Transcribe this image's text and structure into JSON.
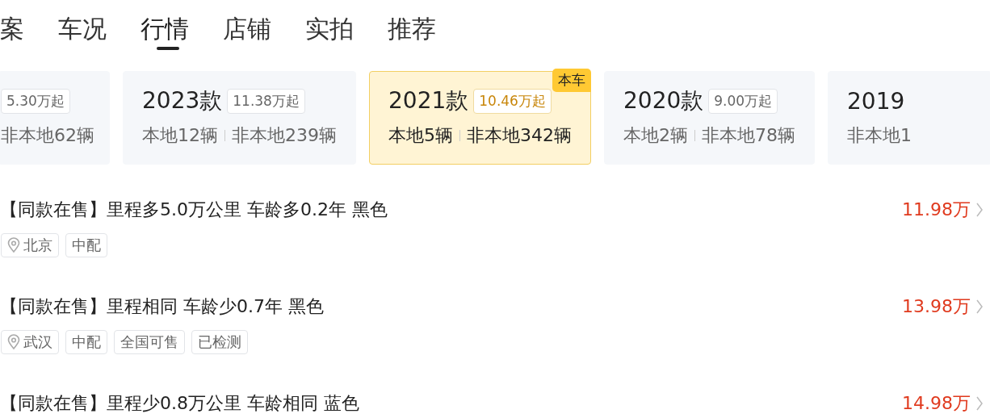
{
  "tabs": [
    {
      "label": "案",
      "selected": false
    },
    {
      "label": "车况",
      "selected": false
    },
    {
      "label": "行情",
      "selected": true
    },
    {
      "label": "店铺",
      "selected": false
    },
    {
      "label": "实拍",
      "selected": false
    },
    {
      "label": "推荐",
      "selected": false
    }
  ],
  "model_years": [
    {
      "price": "5.30万起",
      "nonlocal": "非本地62辆",
      "selected": false
    },
    {
      "year": "2023款",
      "price": "11.38万起",
      "local": "本地12辆",
      "nonlocal": "非本地239辆",
      "selected": false
    },
    {
      "year": "2021款",
      "price": "10.46万起",
      "local": "本地5辆",
      "nonlocal": "非本地342辆",
      "selected": true,
      "badge": "本车"
    },
    {
      "year": "2020款",
      "price": "9.00万起",
      "local": "本地2辆",
      "nonlocal": "非本地78辆",
      "selected": false
    },
    {
      "year": "2019",
      "nonlocal": "非本地1",
      "selected": false
    }
  ],
  "listings": [
    {
      "title": "【同款在售】里程多5.0万公里 车龄多0.2年 黑色",
      "price": "11.98万",
      "location": "北京",
      "tags": [
        "中配"
      ]
    },
    {
      "title": "【同款在售】里程相同 车龄少0.7年 黑色",
      "price": "13.98万",
      "location": "武汉",
      "tags": [
        "中配",
        "全国可售",
        "已检测"
      ]
    },
    {
      "title": "【同款在售】里程少0.8万公里 车龄相同 蓝色",
      "price": "14.98万"
    }
  ]
}
